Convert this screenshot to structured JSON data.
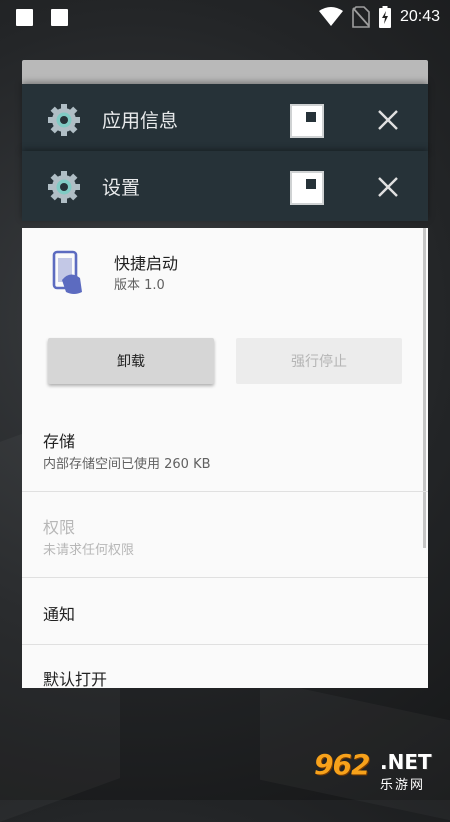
{
  "status_bar": {
    "time": "20:43"
  },
  "recents": {
    "cards": [
      {
        "title": "应用信息",
        "icon": "gear-icon"
      },
      {
        "title": "设置",
        "icon": "gear-icon"
      }
    ]
  },
  "app_info": {
    "app_name": "快捷启动",
    "version": "版本 1.0",
    "buttons": {
      "uninstall": "卸载",
      "force_stop": "强行停止"
    },
    "sections": [
      {
        "title": "存储",
        "subtitle": "内部存储空间已使用 260 KB",
        "enabled": true
      },
      {
        "title": "权限",
        "subtitle": "未请求任何权限",
        "enabled": false
      },
      {
        "title": "通知",
        "subtitle": "",
        "enabled": true
      },
      {
        "title": "默认打开",
        "subtitle": "",
        "enabled": true
      }
    ]
  },
  "watermark": {
    "number": "962",
    "suffix": ".NET",
    "site": "乐游网"
  },
  "colors": {
    "header_bg": "#263238",
    "gear_accent": "#80cbc4",
    "app_icon_accent": "#5c6bc0",
    "watermark_orange": "#f7a21b"
  }
}
